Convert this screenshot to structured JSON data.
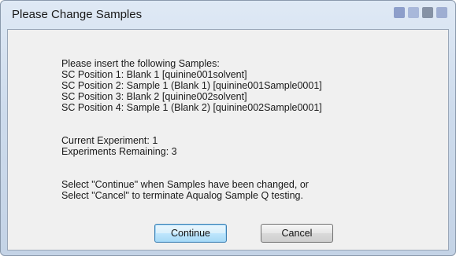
{
  "window": {
    "title": "Please Change Samples"
  },
  "message": {
    "intro": "Please insert the following Samples:",
    "positions": [
      "SC Position 1: Blank 1 [quinine001solvent]",
      "SC Position 2: Sample 1 (Blank 1) [quinine001Sample0001]",
      "SC Position 3: Blank 2 [quinine002solvent]",
      "SC Position 4: Sample 1 (Blank 2) [quinine002Sample0001]"
    ],
    "current_experiment": "Current Experiment: 1",
    "experiments_remaining": "Experiments Remaining: 3",
    "instruction_1": "Select \"Continue\" when Samples have been changed, or",
    "instruction_2": "Select \"Cancel\" to terminate Aqualog Sample Q testing."
  },
  "buttons": {
    "continue_label": "Continue",
    "cancel_label": "Cancel"
  },
  "colors": {
    "title_bar": "#cddbec",
    "client_area": "#f0f0f0",
    "default_button_border": "#3c7fb1"
  }
}
